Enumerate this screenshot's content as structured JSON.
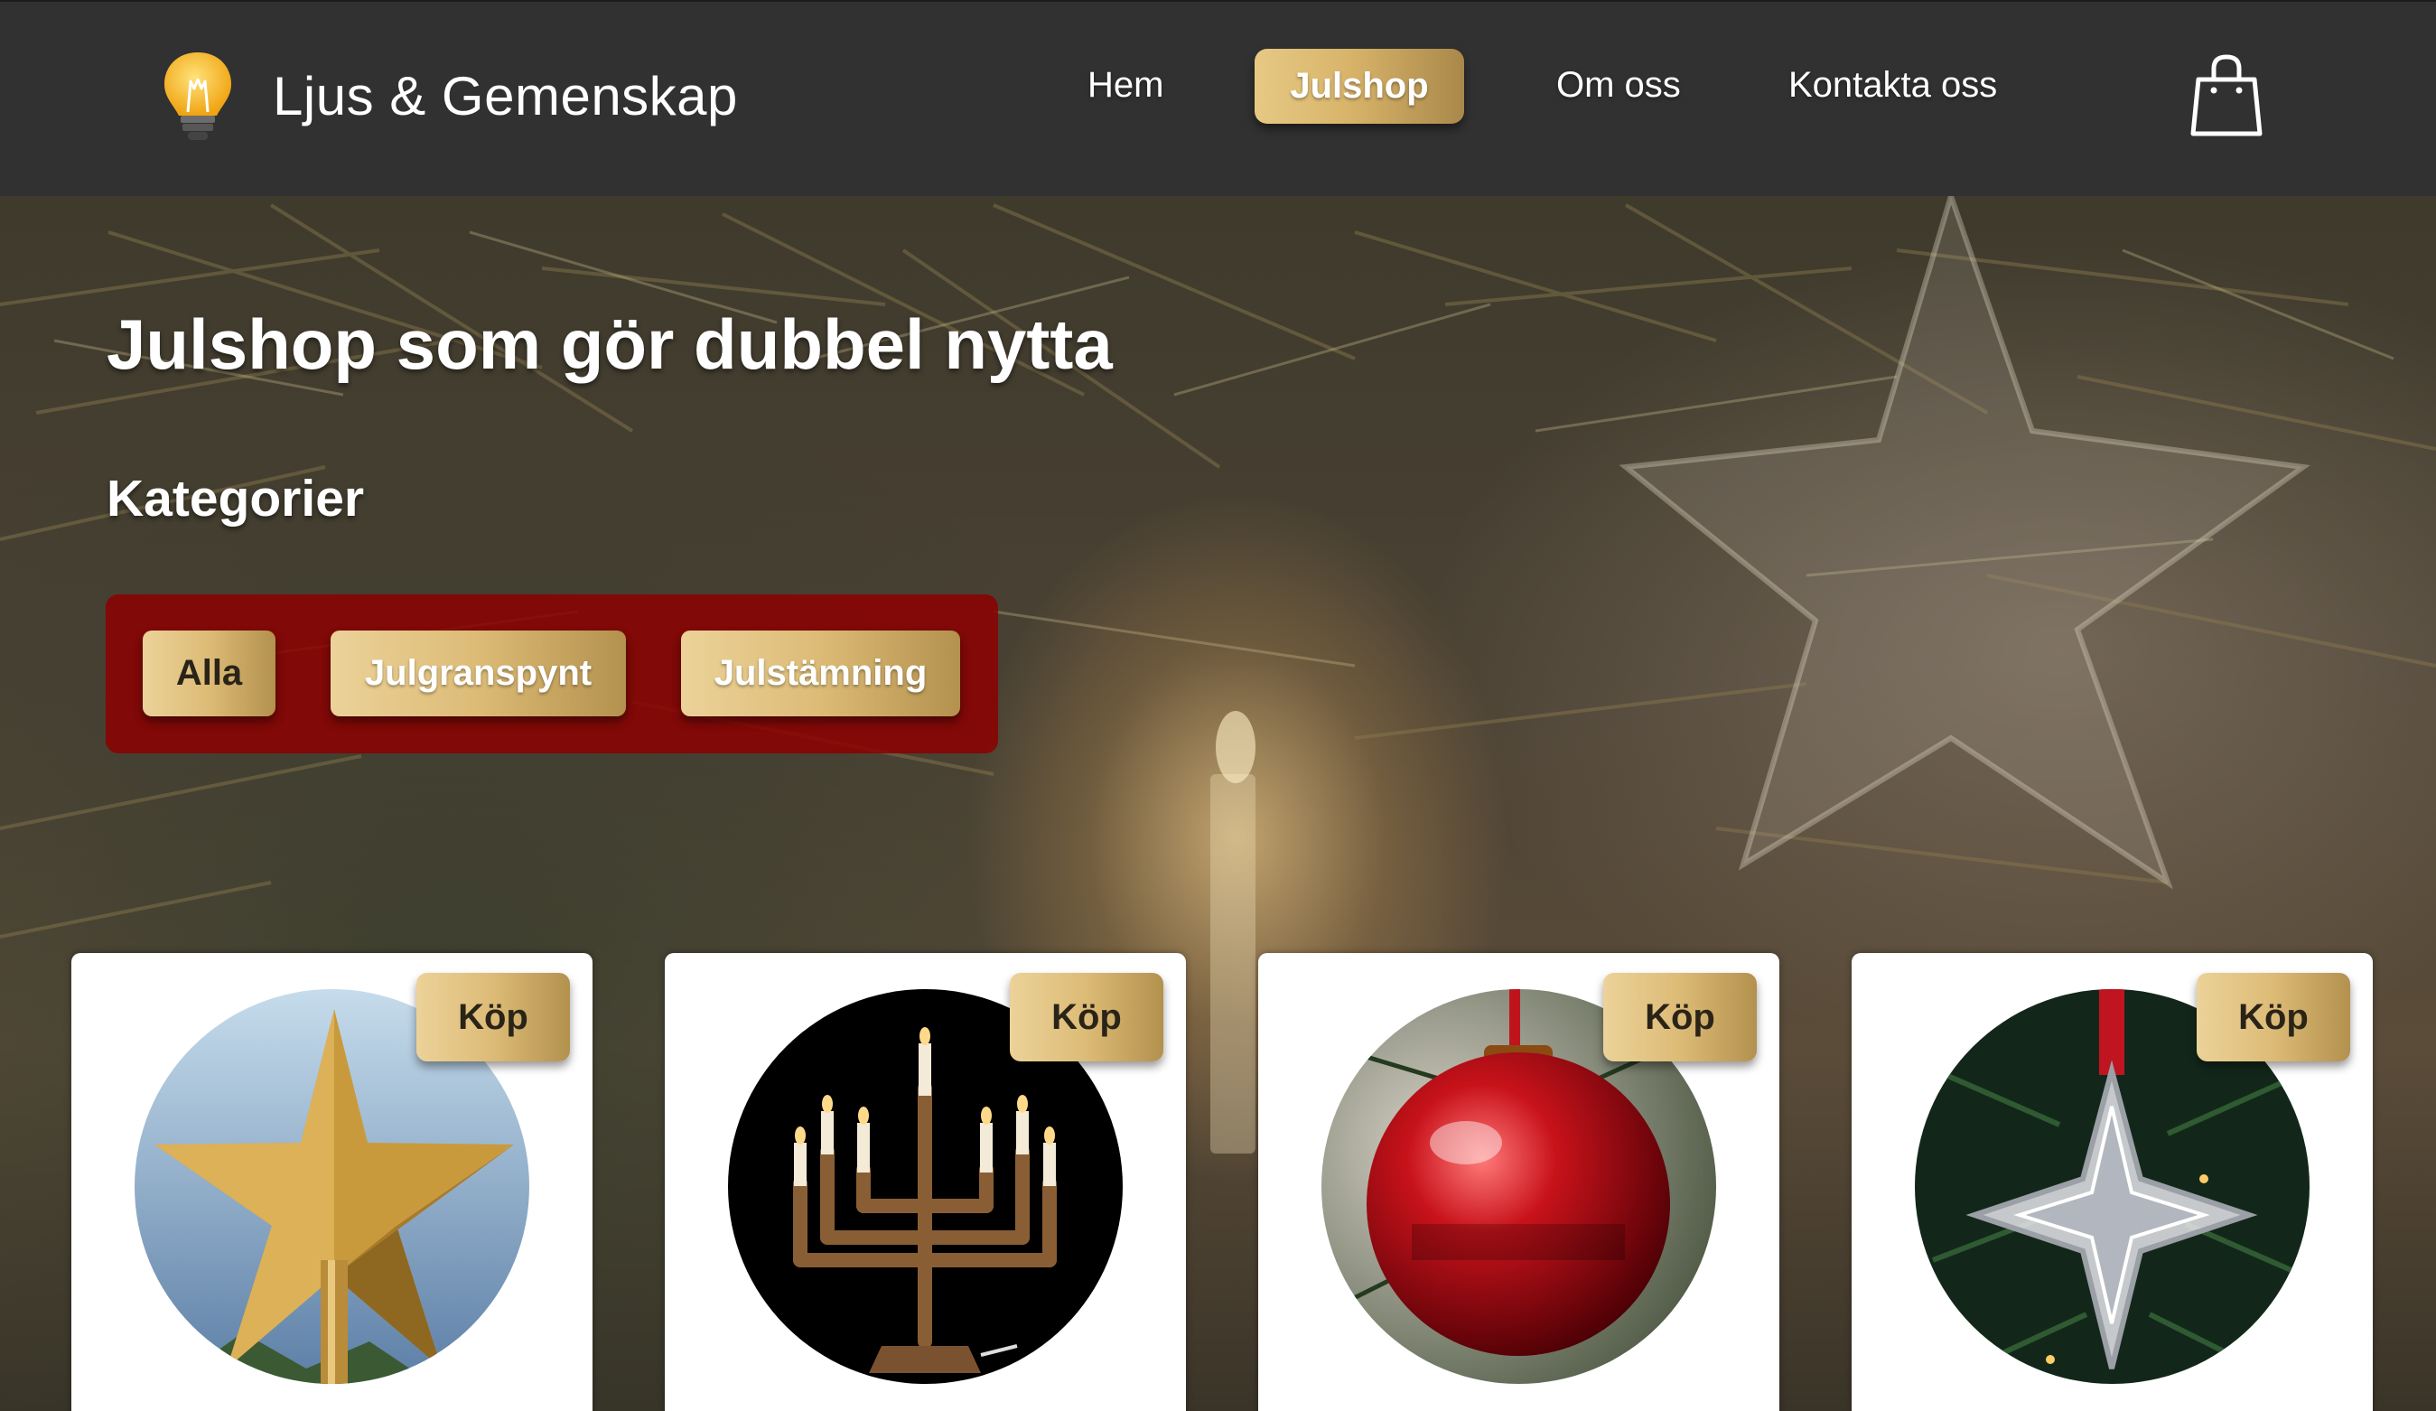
{
  "header": {
    "brand": "Ljus & Gemenskap",
    "logo_icon": "light-bulb-icon",
    "nav": [
      {
        "label": "Hem",
        "active": false
      },
      {
        "label": "Julshop",
        "active": true
      },
      {
        "label": "Om oss",
        "active": false
      },
      {
        "label": "Kontakta oss",
        "active": false
      }
    ],
    "cart_icon": "shopping-bag-icon"
  },
  "hero": {
    "title": "Julshop som gör dubbel nytta",
    "categories_heading": "Kategorier",
    "categories": [
      {
        "label": "Alla",
        "active": true
      },
      {
        "label": "Julgranspynt",
        "active": false
      },
      {
        "label": "Julstämning",
        "active": false
      }
    ]
  },
  "products": [
    {
      "buy_label": "Köp",
      "image": "gold-star-tree-topper"
    },
    {
      "buy_label": "Köp",
      "image": "wooden-candle-holder"
    },
    {
      "buy_label": "Köp",
      "image": "red-christmas-bauble"
    },
    {
      "buy_label": "Köp",
      "image": "glass-star-ornament"
    }
  ],
  "colors": {
    "header_bg": "#313131",
    "gold_accent": "#d8b46a",
    "category_panel": "#8c0000",
    "card_bg": "#ffffff"
  }
}
